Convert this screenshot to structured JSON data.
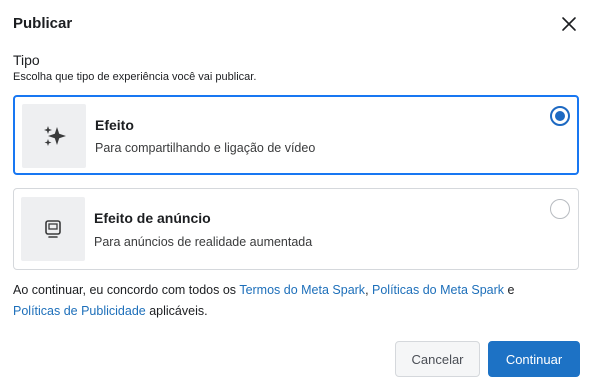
{
  "dialog": {
    "title": "Publicar",
    "close_icon": "close-icon"
  },
  "section": {
    "label": "Tipo",
    "description": "Escolha que tipo de experiência você vai publicar."
  },
  "options": [
    {
      "title": "Efeito",
      "description": "Para compartilhando e ligação de vídeo",
      "icon": "sparkle-icon",
      "selected": true
    },
    {
      "title": "Efeito de anúncio",
      "description": "Para anúncios de realidade aumentada",
      "icon": "ad-display-icon",
      "selected": false
    }
  ],
  "terms": {
    "prefix": "Ao continuar, eu concordo com todos os ",
    "link1": "Termos do Meta Spark",
    "sep1": ", ",
    "link2": "Políticas do Meta Spark",
    "sep2": " e ",
    "link3": "Políticas de Publicidade",
    "suffix": " aplicáveis."
  },
  "buttons": {
    "cancel": "Cancelar",
    "continue": "Continuar"
  },
  "colors": {
    "accent": "#1877f2",
    "primary_button": "#1d72c5",
    "link": "#1d6fba"
  }
}
